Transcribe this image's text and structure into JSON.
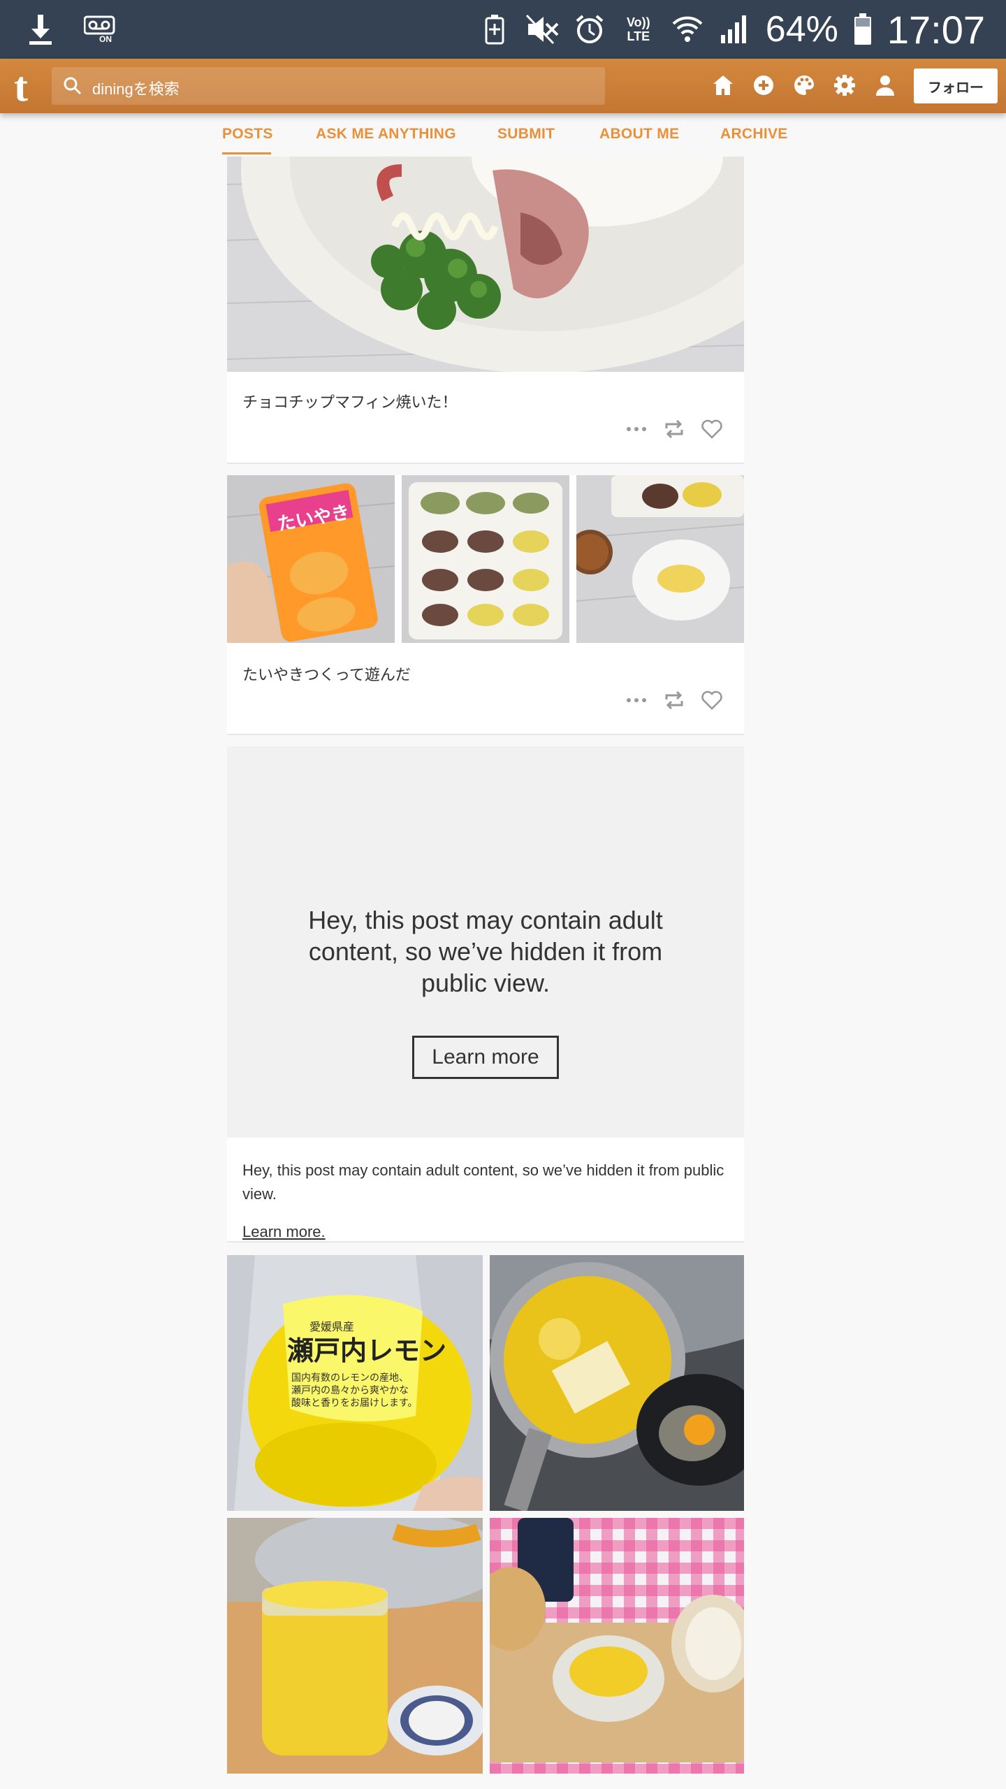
{
  "status_bar": {
    "battery_percent": "64%",
    "time": "17:07",
    "icons": [
      "download-icon",
      "voicemail-icon",
      "battery-saver-icon",
      "mute-icon",
      "alarm-icon",
      "volte-icon",
      "wifi-icon",
      "signal-icon",
      "battery-icon"
    ],
    "volte_label": "Vo)) LTE"
  },
  "header": {
    "logo": "t",
    "search_placeholder": "diningを検索",
    "follow_label": "フォロー",
    "icons": [
      "home-icon",
      "compose-icon",
      "palette-icon",
      "settings-icon",
      "account-icon"
    ]
  },
  "nav": {
    "tabs": [
      {
        "label": "POSTS",
        "active": true
      },
      {
        "label": "ASK ME ANYTHING",
        "active": false
      },
      {
        "label": "SUBMIT",
        "active": false
      },
      {
        "label": "ABOUT ME",
        "active": false
      },
      {
        "label": "ARCHIVE",
        "active": false
      }
    ]
  },
  "posts": [
    {
      "caption": "チョコチップマフィン焼いた！",
      "photos": [
        "plate-broccoli-bacon-photo"
      ]
    },
    {
      "caption": "たいやきつくって遊んだ",
      "photos": [
        "taiyaki-mold-photo",
        "taiyaki-plate-photo",
        "taiyaki-tea-photo"
      ]
    },
    {
      "hidden": true,
      "overlay_message": "Hey, this post may contain adult content, so we’ve hidden it from public view.",
      "learn_more_button": "Learn more",
      "body_text": "Hey, this post may contain adult content, so we’ve hidden it from public view.",
      "learn_more_link": "Learn more."
    },
    {
      "photos": [
        "lemon-package-photo",
        "butter-pan-egg-photo",
        "lemon-curd-jar-photo",
        "lemon-curd-bread-photo"
      ],
      "package_text": {
        "line1": "愛媛県産",
        "line2": "瀬戸内レモン",
        "line3": "国内有数のレモンの産地、",
        "line4": "瀬戸内の島々から爽やかな",
        "line5": "酸味と香りをお届けします。"
      }
    }
  ],
  "colors": {
    "status_bar_bg": "#354254",
    "header_bg": "#c87a33",
    "accent": "#e8913a"
  }
}
